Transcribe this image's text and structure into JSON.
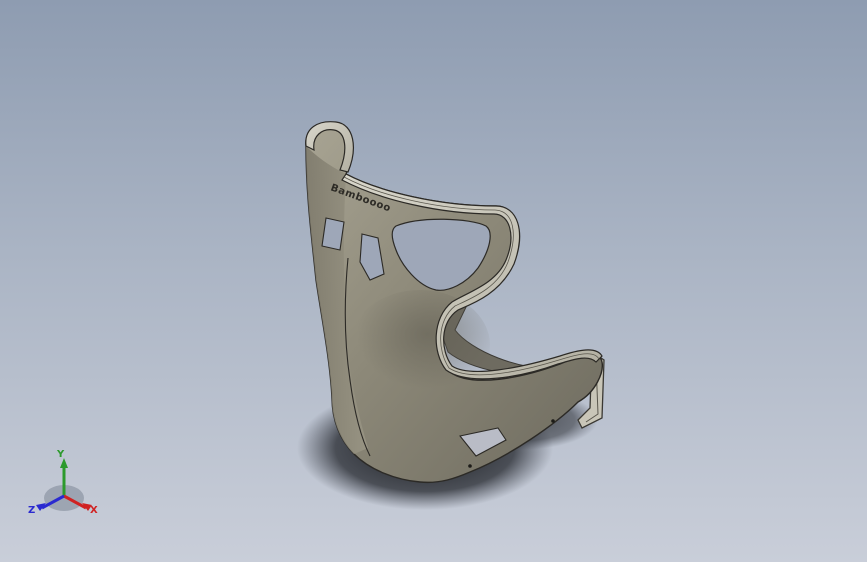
{
  "viewport": {
    "background_top": "#8e9cb1",
    "background_bottom": "#c9ced9"
  },
  "model": {
    "part": "racing-bucket-seat",
    "surface_color": "#8e8b7d",
    "embossed_text": "Bamboooo"
  },
  "triad": {
    "x_label": "X",
    "y_label": "Y",
    "z_label": "Z",
    "x_color": "#d02222",
    "y_color": "#2c9a2c",
    "z_color": "#2a2ad0"
  }
}
